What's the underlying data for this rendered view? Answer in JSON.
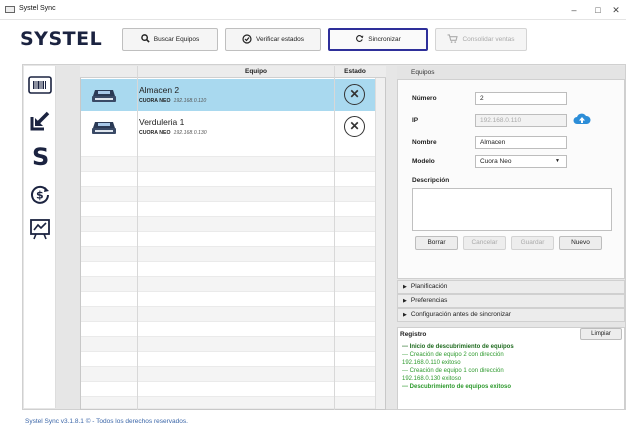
{
  "window": {
    "title": "Systel Sync",
    "minimize": "–",
    "maximize": "□",
    "close": "✕"
  },
  "header": {
    "logo": "SYSTEL"
  },
  "toolbar": {
    "buscar": "Buscar Equipos",
    "verificar": "Verificar estados",
    "sincronizar": "Sincronizar",
    "consolidar": "Consolidar ventas"
  },
  "sidebar": {
    "items": [
      {
        "icon": "barcode-icon"
      },
      {
        "icon": "import-arrow-icon"
      },
      {
        "icon": "systel-s-icon"
      },
      {
        "icon": "money-cycle-icon"
      },
      {
        "icon": "chart-board-icon"
      }
    ]
  },
  "table": {
    "headers": {
      "equipo": "Equipo",
      "estado": "Estado"
    },
    "rows": [
      {
        "name": "Almacen 2",
        "model": "CUORA NEO",
        "ip": "192.168.0.110",
        "status": "✕",
        "selected": true
      },
      {
        "name": "Verduleria 1",
        "model": "CUORA NEO",
        "ip": "192.168.0.130",
        "status": "✕",
        "selected": false
      }
    ]
  },
  "equipos": {
    "title": "Equipos",
    "numero_label": "Número",
    "numero": "2",
    "ip_label": "IP",
    "ip": "192.168.0.110",
    "nombre_label": "Nombre",
    "nombre": "Almacen",
    "modelo_label": "Modelo",
    "modelo": "Cuora Neo",
    "descripcion_label": "Descripción",
    "buttons": {
      "borrar": "Borrar",
      "cancelar": "Cancelar",
      "guardar": "Guardar",
      "nuevo": "Nuevo"
    }
  },
  "accordions": {
    "planificacion": "Planificación",
    "preferencias": "Preferencias",
    "configuracion": "Configuración antes de sincronizar"
  },
  "registro": {
    "title": "Registro",
    "clear": "Limpiar",
    "lines": [
      "--- Inicio de descubrimiento de equipos",
      "--- Creación de equipo 2 con dirección",
      "192.168.0.110 exitoso",
      "--- Creación de equipo 1 con dirección",
      "192.168.0.130 exitoso",
      "--- Descubrimiento de equipos exitoso"
    ]
  },
  "footer": {
    "text": "Systel Sync v3.1.8.1 © - Todos los derechos reservados."
  },
  "colors": {
    "accent": "#2e2f9a",
    "selected_row": "#a9d9ef",
    "log_green": "#2e9a2e",
    "logo": "#1b2340"
  }
}
